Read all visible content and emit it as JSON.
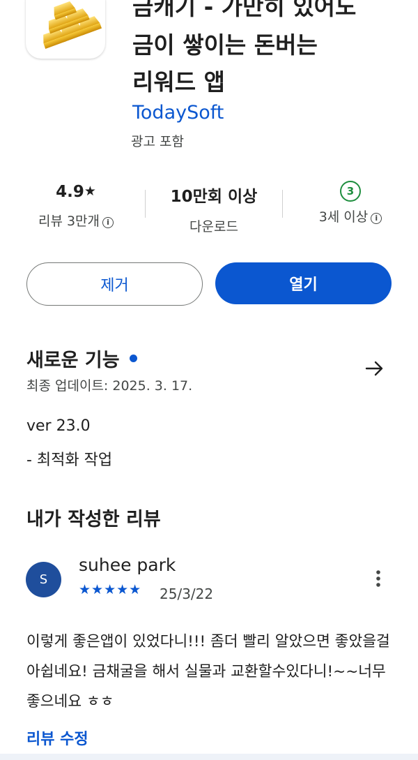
{
  "app": {
    "title_lines": [
      "금캐기 - 가만히 있어도",
      "금이 쌓이는 돈버는",
      "리워드 앱"
    ],
    "developer": "TodaySoft",
    "ads_label": "광고 포함",
    "icon": "gold-bars-icon"
  },
  "stats": {
    "rating": "4.9",
    "rating_star": "★",
    "reviews_label": "리뷰 3만개",
    "downloads": "10만회 이상",
    "downloads_label": "다운로드",
    "age_badge": "3",
    "age_label": "3세 이상",
    "info_glyph": "i"
  },
  "buttons": {
    "remove": "제거",
    "open": "열기"
  },
  "whats_new": {
    "title": "새로운 기능",
    "updated": "최종 업데이트: 2025. 3. 17.",
    "notes": [
      "ver 23.0",
      "- 최적화 작업"
    ]
  },
  "my_review": {
    "title": "내가 작성한 리뷰",
    "avatar_letter": "S",
    "reviewer": "suhee park",
    "stars": "★★★★★",
    "rating": 5,
    "date": "25/3/22",
    "text": "이렇게 좋은앱이 있었다니!!! 좀더 빨리 알았으면 좋았을걸 아쉽네요! 금채굴을 해서 실물과 교환할수있다니!~~너무 좋으네요 ㅎㅎ",
    "edit_label": "리뷰 수정"
  },
  "colors": {
    "accent": "#0b57d0",
    "age_green": "#1e8e3e",
    "avatar": "#1f4e9c"
  }
}
